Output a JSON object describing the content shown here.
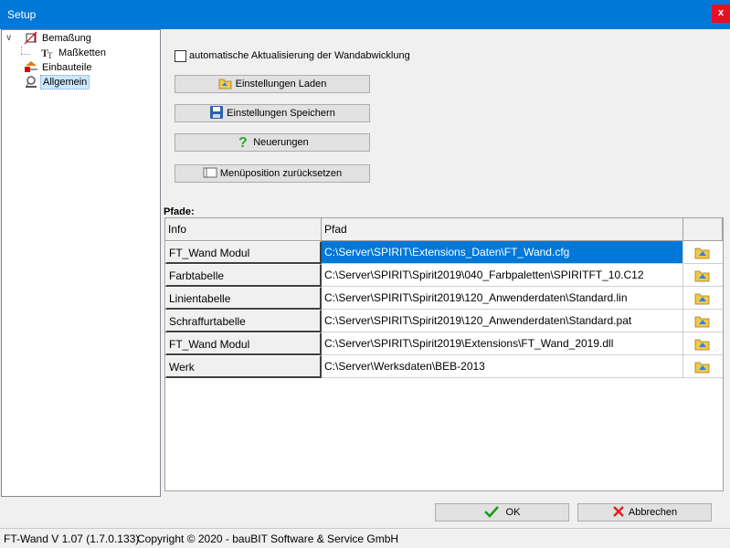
{
  "window": {
    "title": "Setup",
    "close_label": "x"
  },
  "tree": {
    "items": [
      {
        "label": "Bemaßung",
        "icon": "dimension-icon",
        "expanded": true
      },
      {
        "label": "Maßketten",
        "icon": "text-icon"
      },
      {
        "label": "Einbauteile",
        "icon": "component-icon"
      },
      {
        "label": "Allgemein",
        "icon": "settings-icon",
        "selected": true
      }
    ]
  },
  "general": {
    "auto_update_label": "automatische Aktualisierung der Wandabwicklung",
    "auto_update_checked": false,
    "buttons": {
      "load": "Einstellungen Laden",
      "save": "Einstellungen Speichern",
      "news": "Neuerungen",
      "reset_menu": "Menüposition zurücksetzen"
    }
  },
  "paths": {
    "label": "Pfade:",
    "columns": {
      "info": "Info",
      "path": "Pfad"
    },
    "rows": [
      {
        "info": "FT_Wand Modul",
        "path": "C:\\Server\\SPIRIT\\Extensions_Daten\\FT_Wand.cfg",
        "selected": true
      },
      {
        "info": "Farbtabelle",
        "path": "C:\\Server\\SPIRIT\\Spirit2019\\040_Farbpaletten\\SPIRITFT_10.C12"
      },
      {
        "info": "Linientabelle",
        "path": "C:\\Server\\SPIRIT\\Spirit2019\\120_Anwenderdaten\\Standard.lin"
      },
      {
        "info": "Schraffurtabelle",
        "path": "C:\\Server\\SPIRIT\\Spirit2019\\120_Anwenderdaten\\Standard.pat"
      },
      {
        "info": "FT_Wand Modul",
        "path": "C:\\Server\\SPIRIT\\Spirit2019\\Extensions\\FT_Wand_2019.dll"
      },
      {
        "info": "Werk",
        "path": "C:\\Server\\Werksdaten\\BEB-2013"
      }
    ]
  },
  "footer": {
    "ok": "OK",
    "cancel": "Abbrechen"
  },
  "status": {
    "version": "FT-Wand V 1.07 (1.7.0.133)",
    "copyright": "Copyright © 2020 - bauBIT Software & Service GmbH"
  },
  "colors": {
    "accent": "#0078d7",
    "close": "#e81123",
    "ok_check": "#1a9b1a",
    "cancel_x": "#e02020"
  }
}
